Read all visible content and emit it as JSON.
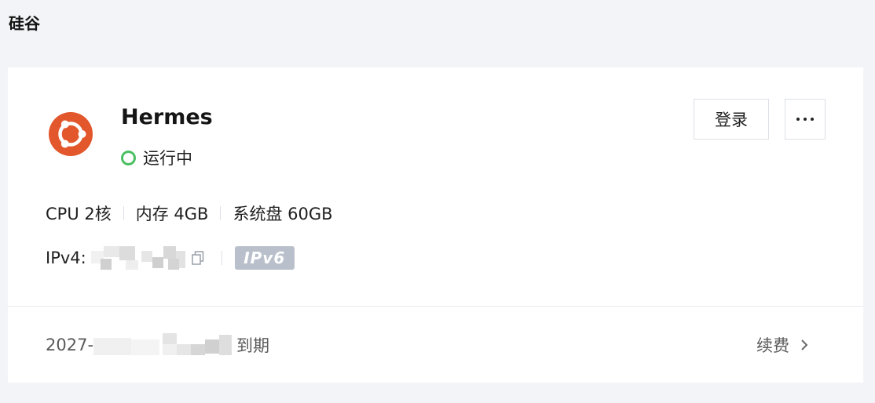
{
  "region": {
    "title": "硅谷"
  },
  "server": {
    "name": "Hermes",
    "status": "运行中",
    "os_icon": "ubuntu-logo"
  },
  "actions": {
    "login_label": "登录",
    "more_icon": "ellipsis-icon"
  },
  "specs": [
    {
      "label": "CPU 2核"
    },
    {
      "label": "内存 4GB"
    },
    {
      "label": "系统盘 60GB"
    }
  ],
  "network": {
    "ipv4_label": "IPv4:",
    "ipv6_badge": "IPv6"
  },
  "billing": {
    "expiry_prefix": "2027-",
    "expiry_suffix": "到期",
    "renew_label": "续费"
  },
  "colors": {
    "status_running": "#4cbf63",
    "ubuntu_orange": "#e2572b",
    "ipv6_badge_bg": "#b9c0cb"
  }
}
